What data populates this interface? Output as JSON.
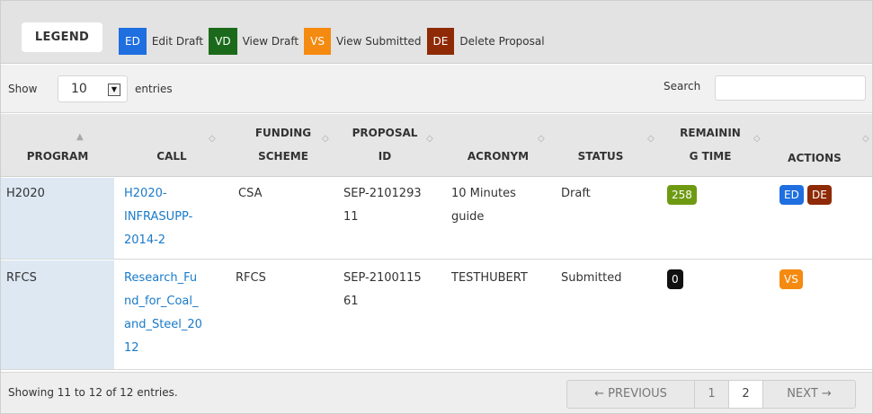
{
  "legend": {
    "title": "LEGEND",
    "items": [
      {
        "code": "ED",
        "label": "Edit Draft",
        "color": "#1f6fe0"
      },
      {
        "code": "VD",
        "label": "View Draft",
        "color": "#1b6a1b"
      },
      {
        "code": "VS",
        "label": "View Submitted",
        "color": "#f58a10"
      },
      {
        "code": "DE",
        "label": "Delete Proposal",
        "color": "#8e2a05"
      }
    ]
  },
  "controls": {
    "show_label": "Show",
    "page_size": "10",
    "entries_label": "entries",
    "search_label": "Search",
    "search_value": ""
  },
  "table": {
    "headers": {
      "program": "PROGRAM",
      "call": "CALL",
      "funding_1": "FUNDING",
      "funding_2": "SCHEME",
      "proposal_1": "PROPOSAL",
      "proposal_2": "ID",
      "acronym": "ACRONYM",
      "status": "STATUS",
      "remaining_1": "REMAININ",
      "remaining_2": "G TIME",
      "actions": "ACTIONS"
    },
    "rows": [
      {
        "program": "H2020",
        "call_lines": [
          "H2020-",
          "INFRASUPP-",
          "2014-2"
        ],
        "funding": "CSA",
        "proposal_lines": [
          "SEP-2101293",
          "11"
        ],
        "acronym_lines": [
          "10 Minutes",
          "guide"
        ],
        "status": "Draft",
        "remaining": "258",
        "remaining_color": "#6e9a12",
        "actions": [
          "ED",
          "DE"
        ]
      },
      {
        "program": "RFCS",
        "call_lines": [
          "Research_Fu",
          "nd_for_Coal_",
          "and_Steel_20",
          "12"
        ],
        "funding": "RFCS",
        "proposal_lines": [
          "SEP-2100115",
          "61"
        ],
        "acronym_lines": [
          "TESTHUBERT"
        ],
        "status": "Submitted",
        "remaining": "0",
        "remaining_color": "#111111",
        "actions": [
          "VS"
        ]
      }
    ]
  },
  "footer": {
    "info": "Showing 11 to 12 of 12 entries.",
    "prev": "← PREVIOUS",
    "page1": "1",
    "page2": "2",
    "next": "NEXT →"
  }
}
